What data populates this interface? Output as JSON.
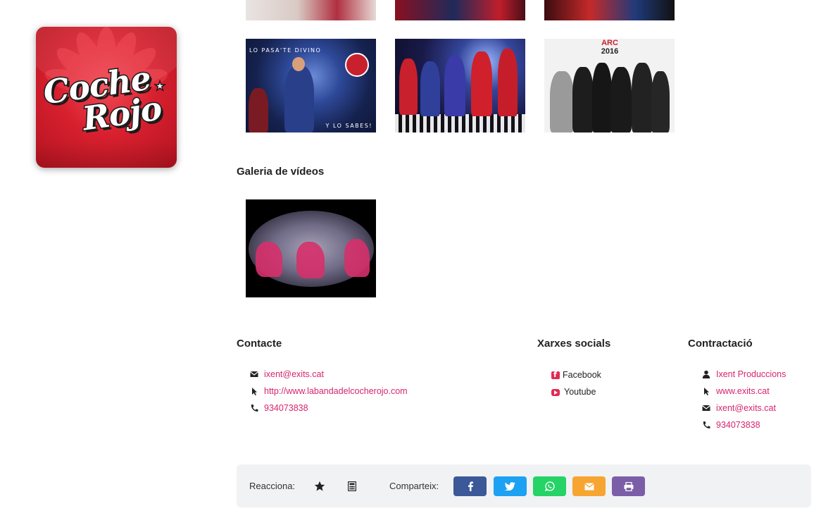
{
  "logo": {
    "line1": "Coche",
    "line2": "Rojo"
  },
  "photos": {
    "caption_top": "LO PASA'TE DIVINO",
    "caption_bottom": "Y LO SABES!",
    "badge_year": "2016",
    "badge_text": "ARC"
  },
  "videos": {
    "heading": "Galeria de vídeos"
  },
  "contacte": {
    "heading": "Contacte",
    "items": [
      {
        "icon": "envelope-icon",
        "text": "ixent@exits.cat"
      },
      {
        "icon": "pointer-icon",
        "text": "http://www.labandadelcocherojo.com"
      },
      {
        "icon": "phone-icon",
        "text": "934073838"
      }
    ]
  },
  "xarxes": {
    "heading": "Xarxes socials",
    "items": [
      {
        "icon": "facebook-icon",
        "text": "Facebook"
      },
      {
        "icon": "youtube-icon",
        "text": "Youtube"
      }
    ]
  },
  "contractacio": {
    "heading": "Contractació",
    "items": [
      {
        "icon": "user-icon",
        "text": "Ixent Produccions"
      },
      {
        "icon": "pointer-icon",
        "text": "www.exits.cat"
      },
      {
        "icon": "envelope-icon",
        "text": "ixent@exits.cat"
      },
      {
        "icon": "phone-icon",
        "text": "934073838"
      }
    ]
  },
  "actions": {
    "react_label": "Reacciona:",
    "share_label": "Comparteix:",
    "colors": {
      "facebook": "#3b5998",
      "twitter": "#1da1f2",
      "whatsapp": "#25d366",
      "email": "#f7a531",
      "print": "#7b5ea7",
      "link": "#d6246e"
    }
  }
}
